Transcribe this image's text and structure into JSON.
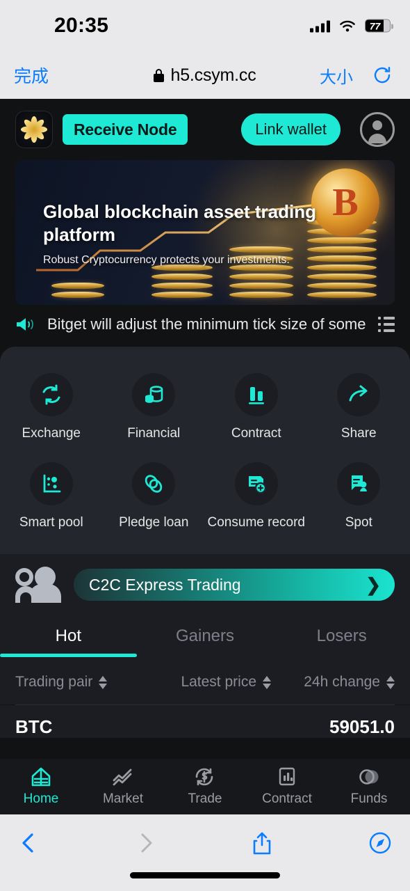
{
  "status_bar": {
    "time": "20:35",
    "battery_level": "77",
    "signal_icon": "cellular-signal-icon",
    "wifi_icon": "wifi-icon",
    "battery_icon": "battery-icon"
  },
  "browser": {
    "done_label": "完成",
    "url": "h5.csym.cc",
    "lock_icon": "lock-icon",
    "size_label": "大小",
    "reload_icon": "reload-icon",
    "back_icon": "back-chevron-icon",
    "forward_icon": "forward-chevron-icon",
    "share_icon": "share-icon",
    "tabs_icon": "safari-compass-icon"
  },
  "app_header": {
    "logo_icon": "app-logo-flower-icon",
    "receive_node_label": "Receive Node",
    "link_wallet_label": "Link wallet",
    "avatar_icon": "user-avatar-icon"
  },
  "banner": {
    "headline": "Global blockchain asset trading platform",
    "subtitle": "Robust Cryptocurrency protects your investments.",
    "bitcoin_symbol": "B"
  },
  "announcement": {
    "speaker_icon": "megaphone-icon",
    "text": "Bitget will adjust the minimum tick size of some spot t",
    "list_icon": "announcement-list-icon"
  },
  "quick_actions": [
    {
      "label": "Exchange",
      "icon": "exchange-swap-icon"
    },
    {
      "label": "Financial",
      "icon": "financial-coins-icon"
    },
    {
      "label": "Contract",
      "icon": "contract-bars-icon"
    },
    {
      "label": "Share",
      "icon": "share-arrow-icon"
    },
    {
      "label": "Smart pool",
      "icon": "smart-pool-scatter-icon"
    },
    {
      "label": "Pledge loan",
      "icon": "pledge-loan-links-icon"
    },
    {
      "label": "Consume record",
      "icon": "consume-record-add-icon"
    },
    {
      "label": "Spot",
      "icon": "spot-document-icon"
    }
  ],
  "c2c": {
    "people_icon": "two-people-icon",
    "label": "C2C Express Trading",
    "chevron_icon": "chevron-right-icon"
  },
  "market": {
    "tabs": [
      {
        "label": "Hot",
        "active": true
      },
      {
        "label": "Gainers",
        "active": false
      },
      {
        "label": "Losers",
        "active": false
      }
    ],
    "columns": [
      {
        "label": "Trading pair",
        "sort_icon": "sort-arrows-icon"
      },
      {
        "label": "Latest price",
        "sort_icon": "sort-arrows-icon"
      },
      {
        "label": "24h change",
        "sort_icon": "sort-arrows-icon"
      }
    ],
    "rows": [
      {
        "pair": "BTC",
        "price": "59051.0"
      }
    ]
  },
  "bottom_nav": [
    {
      "label": "Home",
      "icon": "home-icon",
      "active": true
    },
    {
      "label": "Market",
      "icon": "market-chart-icon",
      "active": false
    },
    {
      "label": "Trade",
      "icon": "trade-swap-icon",
      "active": false
    },
    {
      "label": "Contract",
      "icon": "contract-chart-icon",
      "active": false
    },
    {
      "label": "Funds",
      "icon": "funds-circles-icon",
      "active": false
    }
  ],
  "colors": {
    "accent": "#1de9d5",
    "panel": "#24262d",
    "card": "#1b1d23",
    "page": "#111214",
    "ios_chrome": "#e9e9eb",
    "ios_blue": "#0a7cff"
  }
}
